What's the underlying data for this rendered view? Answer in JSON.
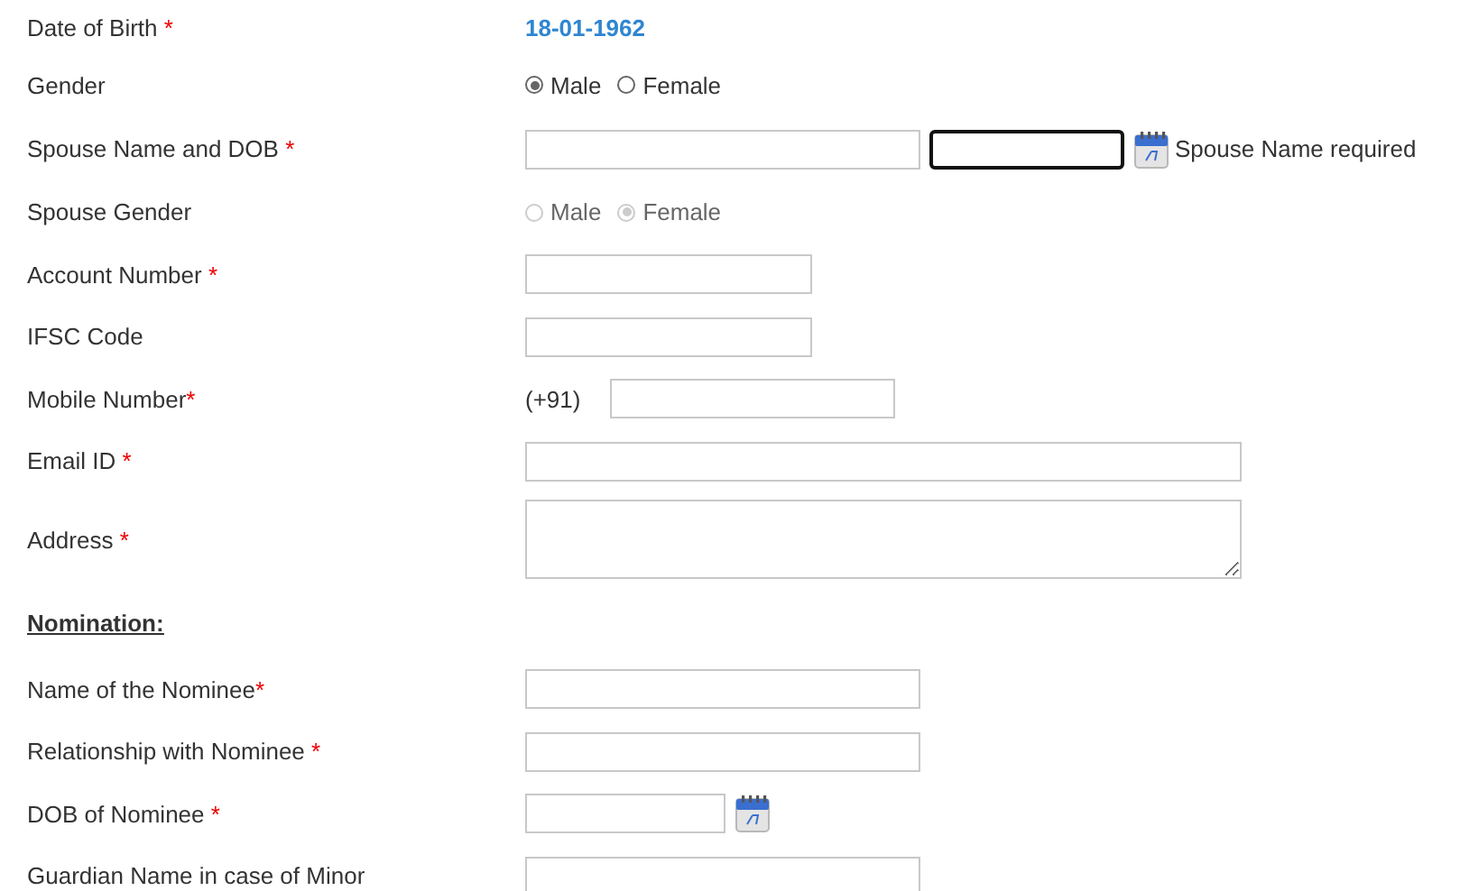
{
  "rows": [
    {
      "kind": "value",
      "label": "Date of Birth",
      "asterisk": " *",
      "value": "18-01-1962"
    },
    {
      "kind": "radio",
      "label": "Gender",
      "disabled": false,
      "options": [
        {
          "label": "Male",
          "selected": true
        },
        {
          "label": "Female",
          "selected": false
        }
      ]
    },
    {
      "kind": "spouse",
      "label": "Spouse Name and DOB",
      "asterisk": " *",
      "dob_focused": true,
      "error": "Spouse Name required"
    },
    {
      "kind": "radio",
      "label": "Spouse Gender",
      "disabled": true,
      "options": [
        {
          "label": "Male",
          "selected": false
        },
        {
          "label": "Female",
          "selected": true
        }
      ]
    },
    {
      "kind": "short",
      "label": "Account Number",
      "asterisk": " *"
    },
    {
      "kind": "short",
      "label": "IFSC Code"
    },
    {
      "kind": "phone",
      "label": "Mobile Number",
      "asterisk": "*",
      "prefix": "(+91)"
    },
    {
      "kind": "wide",
      "label": "Email ID",
      "asterisk": " *"
    },
    {
      "kind": "textarea",
      "label": "Address",
      "asterisk": " *"
    },
    {
      "kind": "heading",
      "label": "Nomination:"
    },
    {
      "kind": "long",
      "label": "Name of the Nominee",
      "asterisk": "*"
    },
    {
      "kind": "long",
      "label": "Relationship with Nominee",
      "asterisk": " *"
    },
    {
      "kind": "date",
      "label": "DOB of Nominee",
      "asterisk": " *"
    },
    {
      "kind": "long",
      "label": "Guardian Name in case of Minor"
    }
  ]
}
